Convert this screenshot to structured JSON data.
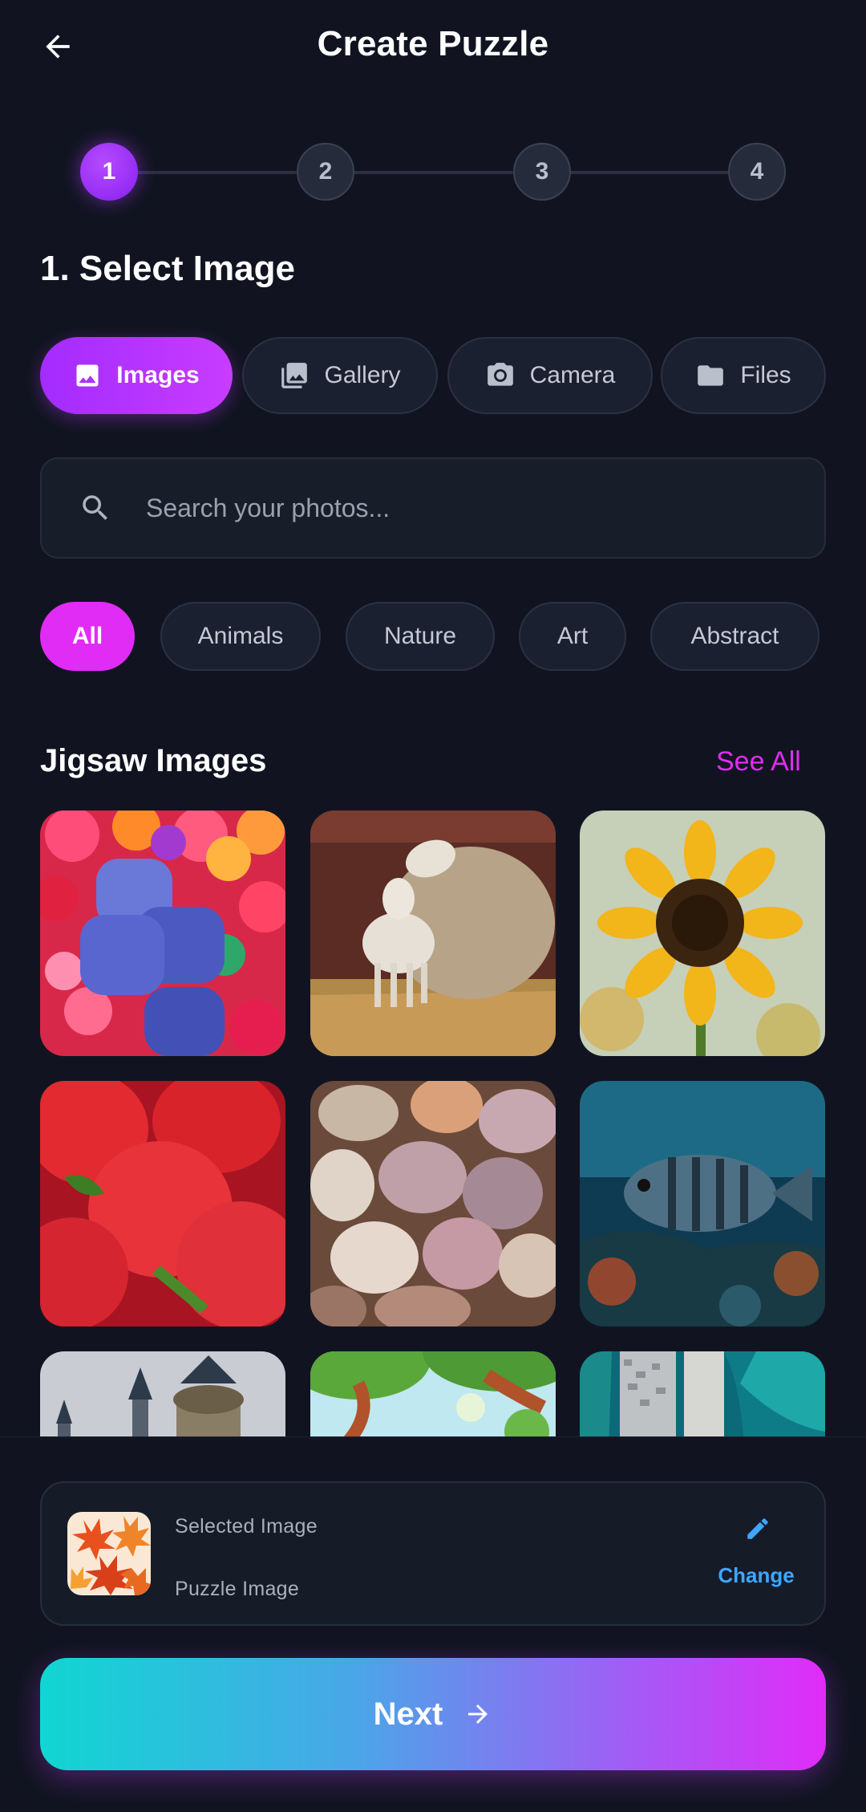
{
  "header": {
    "title": "Create Puzzle",
    "back_icon": "arrow-left-icon"
  },
  "stepper": {
    "steps": [
      "1",
      "2",
      "3",
      "4"
    ],
    "current": 1
  },
  "section_title": "1. Select Image",
  "source_tabs": [
    {
      "label": "Images",
      "icon": "image-icon",
      "active": true
    },
    {
      "label": "Gallery",
      "icon": "photo-library-icon",
      "active": false
    },
    {
      "label": "Camera",
      "icon": "camera-icon",
      "active": false
    },
    {
      "label": "Files",
      "icon": "folder-icon",
      "active": false
    }
  ],
  "search": {
    "placeholder": "Search your photos...",
    "value": ""
  },
  "categories": [
    {
      "label": "All",
      "active": true
    },
    {
      "label": "Animals",
      "active": false
    },
    {
      "label": "Nature",
      "active": false
    },
    {
      "label": "Art",
      "active": false
    },
    {
      "label": "Abstract",
      "active": false
    }
  ],
  "gallery": {
    "title": "Jigsaw Images",
    "see_all": "See All",
    "images": [
      "candy",
      "sheep",
      "sunflower",
      "strawberries",
      "seashells",
      "fish",
      "castle",
      "cartoon-forest",
      "aerial-coast"
    ]
  },
  "selected": {
    "label": "Selected Image",
    "name": "Puzzle Image",
    "change_label": "Change"
  },
  "next_button": {
    "label": "Next"
  },
  "colors": {
    "background": "#111420",
    "accent_purple": "#a32cff",
    "accent_magenta": "#e12cf5",
    "link_blue": "#3ea6ff",
    "gradient_start": "#10d6d2",
    "gradient_end": "#e02cf8"
  }
}
